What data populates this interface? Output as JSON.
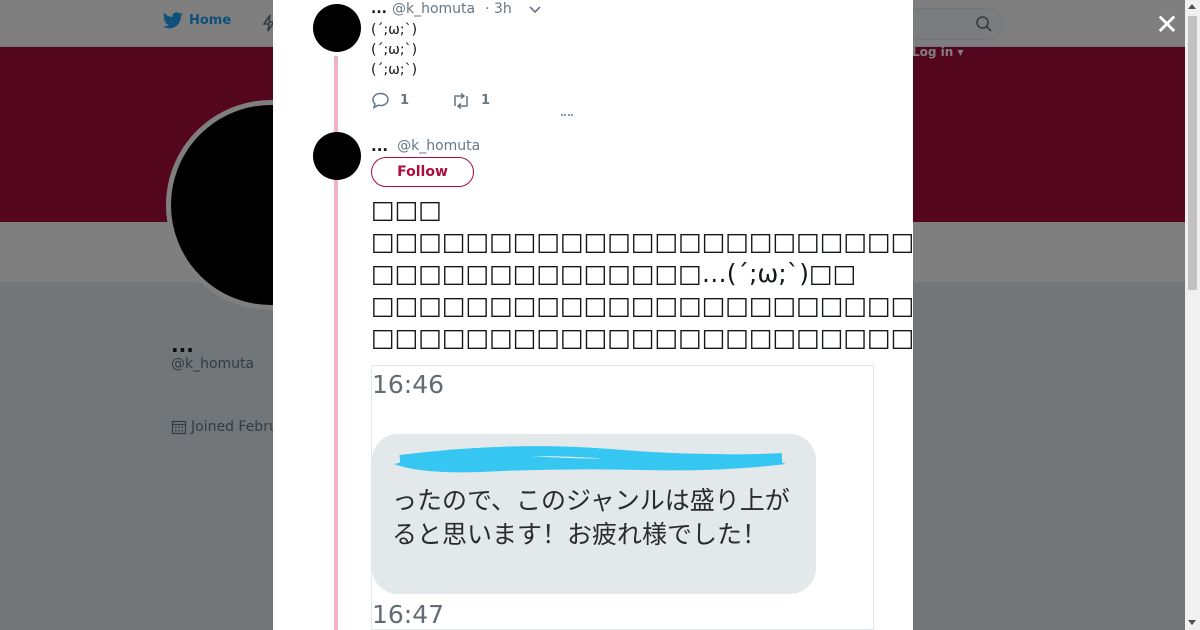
{
  "background": {
    "nav": {
      "home_label": "Home",
      "login_label": "Log in ▾"
    },
    "profile": {
      "name": "...",
      "handle": "@k_homuta",
      "joined": "Joined Febru"
    },
    "colors": {
      "banner": "#ab0d3e",
      "accent": "#1da1f2"
    }
  },
  "modal": {
    "close_label": "✕",
    "tweet1": {
      "name": "...",
      "handle": "@k_homuta",
      "time": "· 3h",
      "body": "(´;ω;`)\n(´;ω;`)\n(´;ω;`)",
      "reply_count": "1",
      "retweet_count": "1"
    },
    "tweet2": {
      "name": "...",
      "handle": "@k_homuta",
      "follow_label": "Follow",
      "body": "□□□\n□□□□□□□□□□□□□□□□□□□□□□□\n□□□□□□□□□□□□□□…(´;ω;`)□□\n□□□□□□□□□□□□□□□□□□□□□□□□□\n□□□□□□□□□□□□□□□□□□□□□□□□□□□□□□□□",
      "photo": {
        "time1": "16:46",
        "message": "ったので、このジャンルは盛り上がると思います！お疲れ様でした！",
        "time2": "16:47"
      }
    }
  }
}
